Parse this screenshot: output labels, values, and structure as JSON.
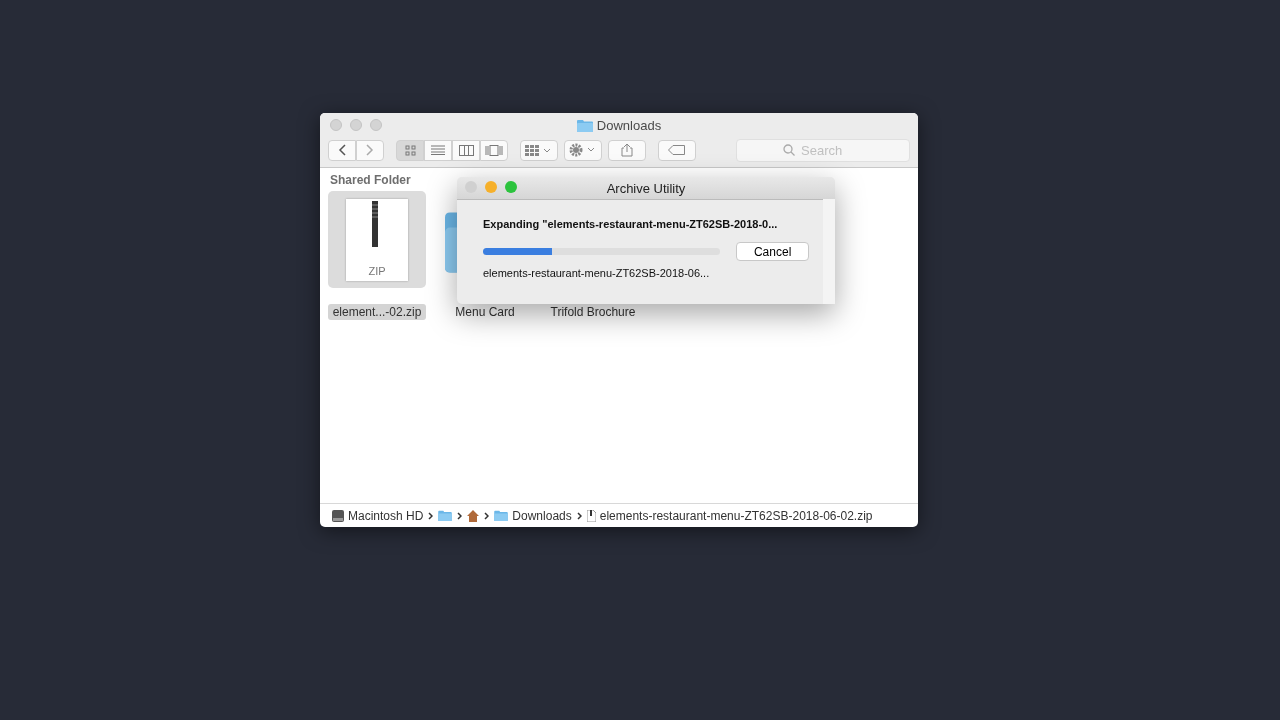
{
  "window": {
    "title": "Downloads"
  },
  "toolbar": {
    "view_buttons": [
      {
        "kind": "icons",
        "selected": true
      },
      {
        "kind": "list",
        "selected": false
      },
      {
        "kind": "columns",
        "selected": false
      },
      {
        "kind": "gallery",
        "selected": false
      }
    ],
    "search": {
      "placeholder": "Search"
    }
  },
  "section_title": "Shared Folder",
  "files": [
    {
      "name": "element...-02.zip",
      "kind": "zip",
      "badge": "ZIP",
      "selected": true
    },
    {
      "name": "Menu Card",
      "kind": "folder",
      "selected": false
    },
    {
      "name": "Trifold Brochure",
      "kind": "covered",
      "selected": false
    }
  ],
  "dialog": {
    "title": "Archive Utility",
    "heading": "Expanding \"elements-restaurant-menu-ZT62SB-2018-0...",
    "level": 0.29,
    "current_file": "elements-restaurant-menu-ZT62SB-2018-06...",
    "button": "Cancel"
  },
  "path_bar": [
    {
      "kind": "disk",
      "label": "Macintosh HD"
    },
    {
      "kind": "folder"
    },
    {
      "kind": "home"
    },
    {
      "kind": "folder",
      "label": "Downloads"
    },
    {
      "kind": "file",
      "label": "elements-restaurant-menu-ZT62SB-2018-06-02.zip"
    }
  ]
}
